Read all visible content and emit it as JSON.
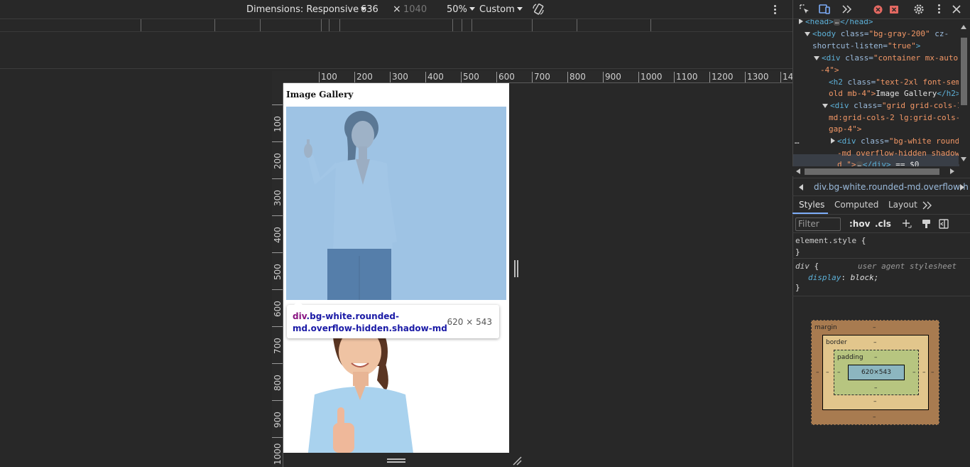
{
  "device_toolbar": {
    "dimensions_label": "Dimensions: Responsive",
    "width": "636",
    "times": "×",
    "height": "1040",
    "zoom": "50%",
    "throttle": "Custom"
  },
  "rulers": {
    "top": [
      "100",
      "200",
      "300",
      "400",
      "500",
      "600",
      "700",
      "800",
      "900",
      "1000",
      "1100",
      "1200",
      "1300",
      "14"
    ],
    "left": [
      "100",
      "200",
      "300",
      "400",
      "500",
      "600",
      "700",
      "800",
      "900",
      "1000"
    ]
  },
  "page": {
    "title": "Image Gallery"
  },
  "tooltip": {
    "tag": "div",
    "classes": ".bg-white.rounded-md.overflow-hidden.shadow-md",
    "size": "620 × 543"
  },
  "elements": {
    "line_head_open": "<head>",
    "line_head_close": "</head>",
    "body_tag": "<body",
    "body_class_attr": "class=",
    "body_class_val": "\"bg-gray-200\"",
    "body_attr2": "cz-",
    "body_attr2b": "shortcut-listen=",
    "body_attr2_val": "\"true\"",
    "div_container": "<div",
    "div_container_class": "class=",
    "div_container_val1": "\"container mx-auto",
    "div_container_val2": "-4\">",
    "h2_open": "<h2",
    "h2_class": "class=",
    "h2_val1": "\"text-2xl font-sem",
    "h2_val2": "old mb-4\">",
    "h2_text": "Image Gallery",
    "h2_close": "</h2>",
    "grid_div": "<div",
    "grid_class": "class=",
    "grid_val1": "\"grid grid-cols-1",
    "grid_val2": "md:grid-cols-2 lg:grid-cols-",
    "grid_val3": "gap-4\">",
    "sel_div": "<div",
    "sel_class": "class=",
    "sel_val1": "\"bg-white round",
    "sel_val2": "-md overflow-hidden shadow",
    "sel_val3": "d \">",
    "sel_close": "</div>",
    "sel_eq": "== $0",
    "dots": "…"
  },
  "breadcrumb": "div.bg-white.rounded-md.overflow-h",
  "tabs": [
    "Styles",
    "Computed",
    "Layout"
  ],
  "filter": {
    "placeholder": "Filter",
    "hov": ":hov",
    "cls": ".cls"
  },
  "styles": {
    "element_style": "element.style",
    "rule_selector": "div",
    "ua": "user agent stylesheet",
    "prop": "display",
    "val": "block;",
    "open": "{",
    "close": "}"
  },
  "box_model": {
    "margin": "margin",
    "border": "border",
    "padding": "padding",
    "content": "620×543",
    "dash": "–"
  },
  "colors": {
    "highlight_overlay": "#6fa8dc",
    "tooltip_tag": "#881280",
    "tooltip_class": "#1a1aa6",
    "tab_underline": "#7cacf8"
  }
}
